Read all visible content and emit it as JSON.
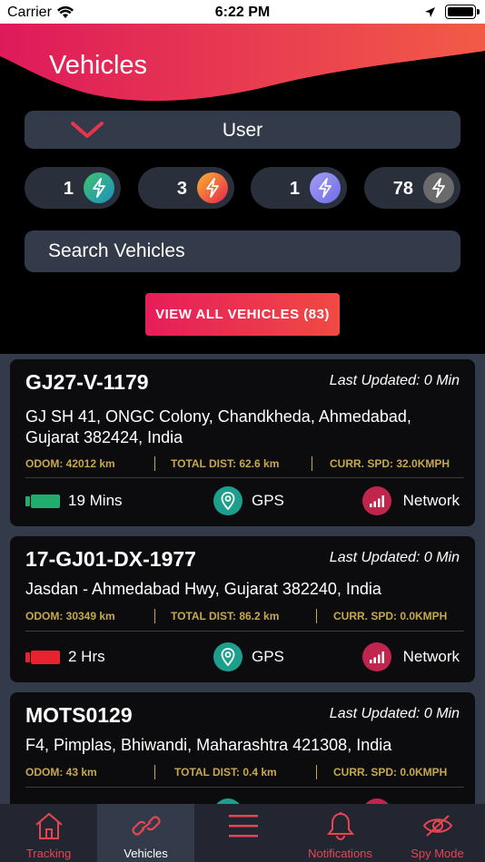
{
  "status_bar": {
    "carrier": "Carrier",
    "time": "6:22 PM"
  },
  "header": {
    "title": "Vehicles"
  },
  "user_dropdown": {
    "label": "User"
  },
  "counters": [
    {
      "value": "1",
      "color": "#2bb673"
    },
    {
      "value": "3",
      "color": "#f0553c"
    },
    {
      "value": "1",
      "color": "#8c86f0"
    },
    {
      "value": "78",
      "color": "#6b6b6b"
    }
  ],
  "search": {
    "placeholder": "Search Vehicles"
  },
  "view_all": {
    "label": "VIEW ALL VEHICLES (83)"
  },
  "vehicles": [
    {
      "reg": "GJ27-V-1179",
      "updated": "Last Updated: 0 Min",
      "address": "GJ SH 41, ONGC Colony, Chandkheda, Ahmedabad, Gujarat 382424, India",
      "odom": "ODOM: 42012 km",
      "total_dist": "TOTAL DIST: 62.6 km",
      "curr_spd": "CURR. SPD: 32.0KMPH",
      "duration": "19 Mins",
      "status_color": "#1fae6e",
      "gps": "GPS",
      "network": "Network"
    },
    {
      "reg": "17-GJ01-DX-1977",
      "updated": "Last Updated: 0 Min",
      "address": "Jasdan - Ahmedabad Hwy, Gujarat 382240, India",
      "odom": "ODOM: 30349 km",
      "total_dist": "TOTAL DIST: 86.2 km",
      "curr_spd": "CURR. SPD: 0.0KMPH",
      "duration": "2 Hrs",
      "status_color": "#e8232f",
      "gps": "GPS",
      "network": "Network"
    },
    {
      "reg": "MOTS0129",
      "updated": "Last Updated: 0 Min",
      "address": "F4, Pimplas, Bhiwandi, Maharashtra 421308, India",
      "odom": "ODOM: 43 km",
      "total_dist": "TOTAL DIST: 0.4 km",
      "curr_spd": "CURR. SPD: 0.0KMPH",
      "duration": "",
      "status_color": "#e8232f",
      "gps": "",
      "network": ""
    }
  ],
  "tabs": [
    {
      "label": "Tracking",
      "icon": "home-icon"
    },
    {
      "label": "Vehicles",
      "icon": "link-icon"
    },
    {
      "label": "",
      "icon": "menu-icon"
    },
    {
      "label": "Notifications",
      "icon": "bell-icon"
    },
    {
      "label": "Spy Mode",
      "icon": "eye-icon"
    }
  ],
  "colors": {
    "accent": "#e61d5a",
    "panel": "#333a4a",
    "gold": "#c8a84e"
  }
}
